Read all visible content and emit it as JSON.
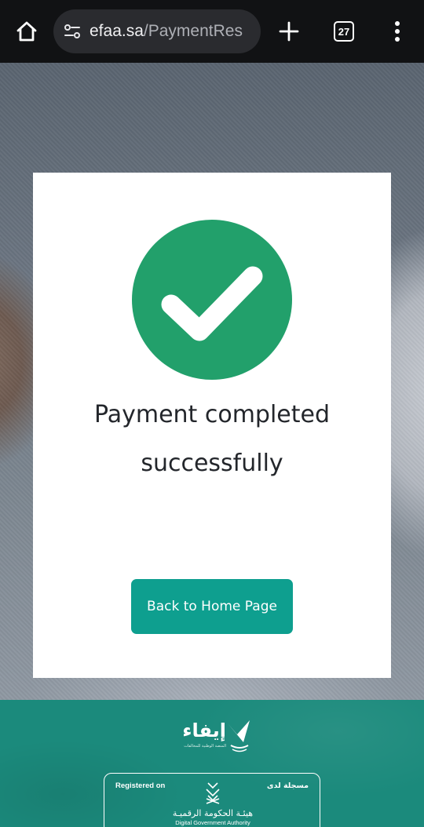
{
  "browser": {
    "url_host": "efaa.sa",
    "url_path": "/PaymentRes",
    "tab_count": "27"
  },
  "card": {
    "message": "Payment completed successfully",
    "button_label": "Back to Home Page",
    "check_color": "#22a06b",
    "button_color": "#0e9f8f"
  },
  "footer": {
    "brand_ar": "إيفاء",
    "brand_sub_ar": "المنصة الوطنية للمخالفات",
    "registered_en": "Registered on",
    "registered_ar": "مسجلة لدى",
    "dga_ar": "هيئـة الحكومة الرقميـة",
    "dga_en": "Digital Government Authority",
    "background_color": "#1b8a7c"
  }
}
